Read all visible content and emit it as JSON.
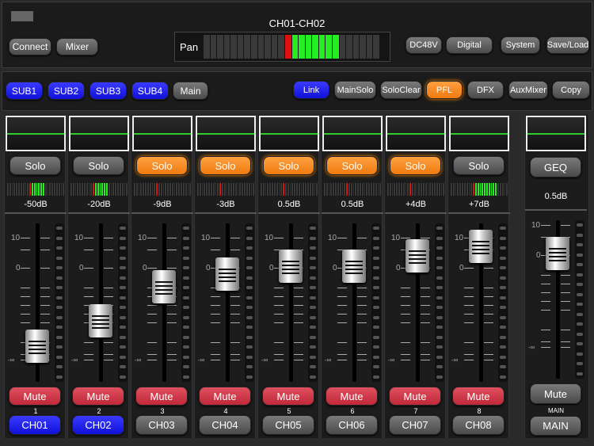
{
  "header": {
    "title": "CH01-CH02",
    "connect": "Connect",
    "mixer": "Mixer",
    "pan_label": "Pan",
    "pan": {
      "segments": 26,
      "center_index": 12,
      "lit_from": 13,
      "lit_to": 19
    },
    "buttons": [
      "DC48V",
      "Digital",
      "System",
      "Save/Load"
    ]
  },
  "toolbar": {
    "subs": [
      {
        "label": "SUB1",
        "active": true
      },
      {
        "label": "SUB2",
        "active": true
      },
      {
        "label": "SUB3",
        "active": true
      },
      {
        "label": "SUB4",
        "active": true
      },
      {
        "label": "Main",
        "active": false
      }
    ],
    "right": [
      {
        "label": "Link",
        "state": "blue"
      },
      {
        "label": "MainSolo",
        "state": "off"
      },
      {
        "label": "SoloClear",
        "state": "off"
      },
      {
        "label": "PFL",
        "state": "orange"
      },
      {
        "label": "DFX",
        "state": "off"
      },
      {
        "label": "AuxMixer",
        "state": "off"
      },
      {
        "label": "Copy",
        "state": "off"
      }
    ]
  },
  "scale": {
    "top": "10",
    "zero": "0",
    "bottom": "-∞"
  },
  "channels": [
    {
      "solo": "Solo",
      "solo_active": false,
      "meter_lit": 6,
      "level": "-50dB",
      "fader_db": -50,
      "mute": "Mute",
      "number": "1",
      "name": "CH01",
      "selected": true
    },
    {
      "solo": "Solo",
      "solo_active": false,
      "meter_lit": 6,
      "level": "-20dB",
      "fader_db": -20,
      "mute": "Mute",
      "number": "2",
      "name": "CH02",
      "selected": true
    },
    {
      "solo": "Solo",
      "solo_active": true,
      "meter_lit": 0,
      "level": "-9dB",
      "fader_db": -9,
      "mute": "Mute",
      "number": "3",
      "name": "CH03",
      "selected": false
    },
    {
      "solo": "Solo",
      "solo_active": true,
      "meter_lit": 0,
      "level": "-3dB",
      "fader_db": -3,
      "mute": "Mute",
      "number": "4",
      "name": "CH04",
      "selected": false
    },
    {
      "solo": "Solo",
      "solo_active": true,
      "meter_lit": 0,
      "level": "0.5dB",
      "fader_db": 0.5,
      "mute": "Mute",
      "number": "5",
      "name": "CH05",
      "selected": false
    },
    {
      "solo": "Solo",
      "solo_active": true,
      "meter_lit": 0,
      "level": "0.5dB",
      "fader_db": 0.5,
      "mute": "Mute",
      "number": "6",
      "name": "CH06",
      "selected": false
    },
    {
      "solo": "Solo",
      "solo_active": true,
      "meter_lit": 0,
      "level": "+4dB",
      "fader_db": 4,
      "mute": "Mute",
      "number": "7",
      "name": "CH07",
      "selected": false
    },
    {
      "solo": "Solo",
      "solo_active": false,
      "meter_lit": 10,
      "level": "+7dB",
      "fader_db": 7,
      "mute": "Mute",
      "number": "8",
      "name": "CH08",
      "selected": false
    }
  ],
  "main": {
    "geq": "GEQ",
    "level": "0.5dB",
    "fader_db": 0.5,
    "mute": "Mute",
    "number": "MAIN",
    "name": "MAIN"
  },
  "colors": {
    "active_blue": "#1a1aee",
    "solo_orange": "#f5821f",
    "mute_red": "#d03545",
    "meter_green": "#22ee22",
    "meter_red": "#e01010"
  }
}
